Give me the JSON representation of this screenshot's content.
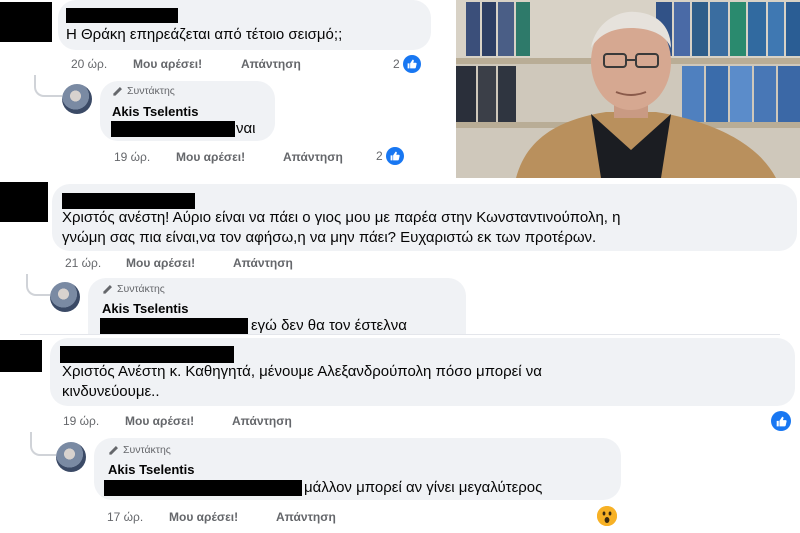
{
  "comments": [
    {
      "text": "Η Θράκη επηρεάζεται από τέτοιο σεισμό;;",
      "time": "20 ώρ.",
      "like_label": "Μου αρέσει!",
      "reply_label": "Απάντηση",
      "reaction_count": "2",
      "reply": {
        "author_tag": "Συντάκτης",
        "author_name": "Akis Tselentis",
        "text": "ναι",
        "time": "19 ώρ.",
        "like_label": "Μου αρέσει!",
        "reply_label": "Απάντηση",
        "reaction_count": "2"
      }
    },
    {
      "text_line1": "Χριστός ανέστη! Αύριο είναι να πάει ο γιος μου με παρέα στην Κωνσταντινούπολη, η",
      "text_line2": "γνώμη σας πια είναι,να τον αφήσω,η να μην πάει? Ευχαριστώ εκ των προτέρων.",
      "time": "21 ώρ.",
      "like_label": "Μου αρέσει!",
      "reply_label": "Απάντηση",
      "reply": {
        "author_tag": "Συντάκτης",
        "author_name": "Akis Tselentis",
        "text": "εγώ δεν θα τον έστελνα"
      }
    },
    {
      "text_line1": "Χριστός Ανέστη κ. Καθηγητά, μένουμε Αλεξανδρούπολη πόσο μπορεί να",
      "text_line2": "κινδυνεύουμε..",
      "time": "19 ώρ.",
      "like_label": "Μου αρέσει!",
      "reply_label": "Απάντηση",
      "reply": {
        "author_tag": "Συντάκτης",
        "author_name": "Akis Tselentis",
        "text": "μάλλον μπορεί αν γίνει μεγαλύτερος",
        "time": "17 ώρ.",
        "like_label": "Μου αρέσει!",
        "reply_label": "Απάντηση"
      }
    }
  ],
  "colors": {
    "bubble": "#f0f2f5",
    "meta_text": "#65676b",
    "like_blue": "#1877f2",
    "wow_yellow": "#f7b125"
  },
  "icons": {
    "author_tag_icon": "pencil-icon",
    "reaction_like": "thumbs-up-icon",
    "reaction_wow": "wow-face-icon"
  }
}
